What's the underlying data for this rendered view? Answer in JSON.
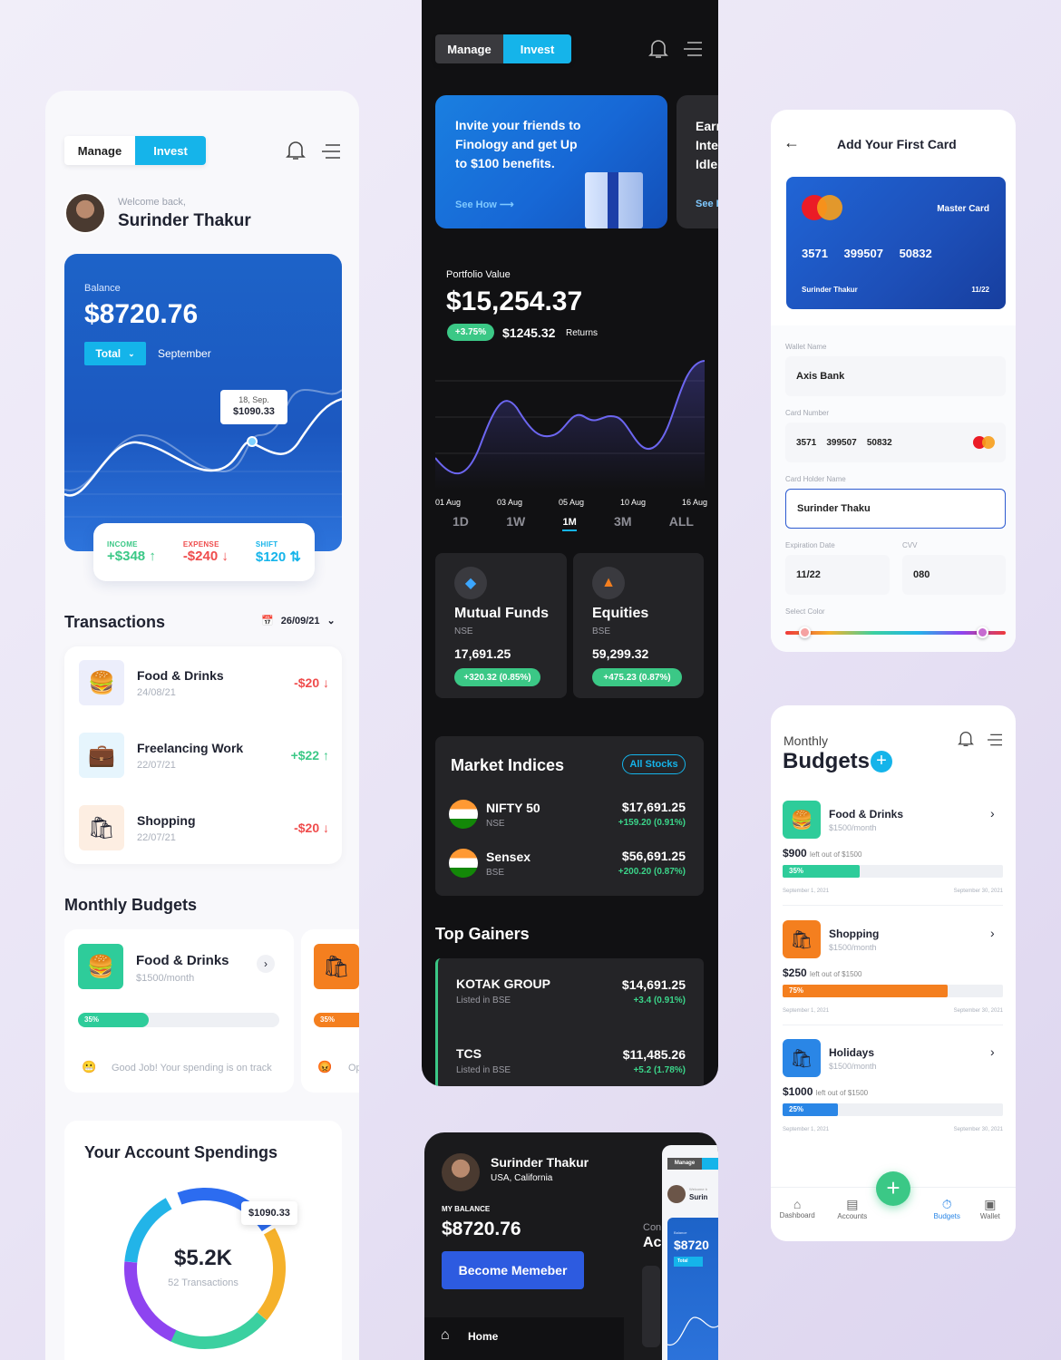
{
  "colors": {
    "accent": "#15b4ea",
    "blue": "#1d63c8",
    "green": "#3bc886",
    "red": "#ef4c4c",
    "orange": "#f47f1f",
    "purple": "#8e44f0"
  },
  "light": {
    "manage": "Manage",
    "invest": "Invest",
    "welcome": "Welcome back,",
    "user": "Surinder Thakur",
    "balance_label": "Balance",
    "balance": "$8720.76",
    "total": "Total",
    "month": "September",
    "tooltip_date": "18, Sep.",
    "tooltip_value": "$1090.33",
    "stats": [
      {
        "label": "INCOME",
        "value": "+$348"
      },
      {
        "label": "EXPENSE",
        "value": "-$240"
      },
      {
        "label": "SHIFT",
        "value": "$120"
      }
    ],
    "tx_title": "Transactions",
    "tx_date": "26/09/21",
    "transactions": [
      {
        "name": "Food & Drinks",
        "date": "24/08/21",
        "amount": "-$20"
      },
      {
        "name": "Freelancing Work",
        "date": "22/07/21",
        "amount": "+$22"
      },
      {
        "name": "Shopping",
        "date": "22/07/21",
        "amount": "-$20"
      }
    ],
    "mb_title": "Monthly Budgets",
    "mb_card": {
      "name": "Food & Drinks",
      "sub": "$1500/month",
      "pct": "35%",
      "pct_value": 0.35,
      "note": "Good Job! Your spending is on track"
    },
    "mb_card2": {
      "pct": "35%",
      "note": "Op"
    },
    "sp_title": "Your Account Spendings",
    "sp_total": "$5.2K",
    "sp_sub": "52 Transactions",
    "sp_tip": "$1090.33"
  },
  "dark": {
    "manage": "Manage",
    "invest": "Invest",
    "promo": "Invite your friends to Finology and get Up to $100 benefits.",
    "promo_link": "See How",
    "promo2_lines": [
      "Earn",
      "Inte",
      "Idle"
    ],
    "promo2_link": "See I",
    "pv_label": "Portfolio Value",
    "pv": "$15,254.37",
    "pv_pct": "+3.75%",
    "pv_ret": "$1245.32",
    "pv_ret_label": "Returns",
    "dates": [
      "01 Aug",
      "03 Aug",
      "05 Aug",
      "10 Aug",
      "16 Aug"
    ],
    "ranges": [
      "1D",
      "1W",
      "1M",
      "3M",
      "ALL"
    ],
    "funds": [
      {
        "name": "Mutual Funds",
        "ex": "NSE",
        "val": "17,691.25",
        "chg": "+320.32 (0.85%)"
      },
      {
        "name": "Equities",
        "ex": "BSE",
        "val": "59,299.32",
        "chg": "+475.23 (0.87%)"
      }
    ],
    "mi_title": "Market Indices",
    "mi_btn": "All Stocks",
    "indices": [
      {
        "name": "NIFTY 50",
        "ex": "NSE",
        "val": "$17,691.25",
        "chg": "+159.20 (0.91%)"
      },
      {
        "name": "Sensex",
        "ex": "BSE",
        "val": "$56,691.25",
        "chg": "+200.20 (0.87%)"
      }
    ],
    "tg_title": "Top Gainers",
    "gainers": [
      {
        "name": "KOTAK GROUP",
        "sub": "Listed in BSE",
        "val": "$14,691.25",
        "chg": "+3.4 (0.91%)"
      },
      {
        "name": "TCS",
        "sub": "Listed in BSE",
        "val": "$11,485.26",
        "chg": "+5.2 (1.78%)"
      }
    ]
  },
  "card": {
    "title": "Add Your First Card",
    "brand": "Master Card",
    "number": [
      "3571",
      "399507",
      "50832"
    ],
    "holder": "Surinder Thakur",
    "exp": "11/22",
    "wallet_label": "Wallet Name",
    "wallet": "Axis Bank",
    "num_label": "Card Number",
    "num": "3571    399507    50832",
    "holder_label": "Card Holder Name",
    "holder_val": "Surinder Thaku",
    "exp_label": "Expiration Date",
    "exp_val": "11/22",
    "cvv_label": "CVV",
    "cvv": "080",
    "color_label": "Select Color"
  },
  "budgets": {
    "t1": "Monthly",
    "t2": "Budgets",
    "items": [
      {
        "name": "Food & Drinks",
        "sub": "$1500/month",
        "left": "$900",
        "of": "left out of $1500",
        "pct": "35%",
        "pct_value": 0.35,
        "start": "September 1, 2021",
        "end": "September 30, 2021"
      },
      {
        "name": "Shopping",
        "sub": "$1500/month",
        "left": "$250",
        "of": "left out of $1500",
        "pct": "75%",
        "pct_value": 0.75,
        "start": "September 1, 2021",
        "end": "September 30, 2021"
      },
      {
        "name": "Holidays",
        "sub": "$1500/month",
        "left": "$1000",
        "of": "left out of $1500",
        "pct": "25%",
        "pct_value": 0.25,
        "start": "September 1, 2021",
        "end": "September 30, 2021"
      }
    ],
    "nav": [
      "Dashboard",
      "Accounts",
      "Budgets",
      "Wallet"
    ]
  },
  "member": {
    "name": "Surinder Thakur",
    "loc": "USA, California",
    "bal_label": "MY BALANCE",
    "bal": "$8720.76",
    "btn": "Become Memeber",
    "home": "Home",
    "mini_manage": "Manage",
    "mini_welcome": "Welcome b",
    "mini_name": "Surin",
    "mini_con": "Con",
    "mini_ac": "Ac",
    "mini_bal_label": "Balance",
    "mini_bal": "$8720",
    "mini_total": "Total"
  }
}
